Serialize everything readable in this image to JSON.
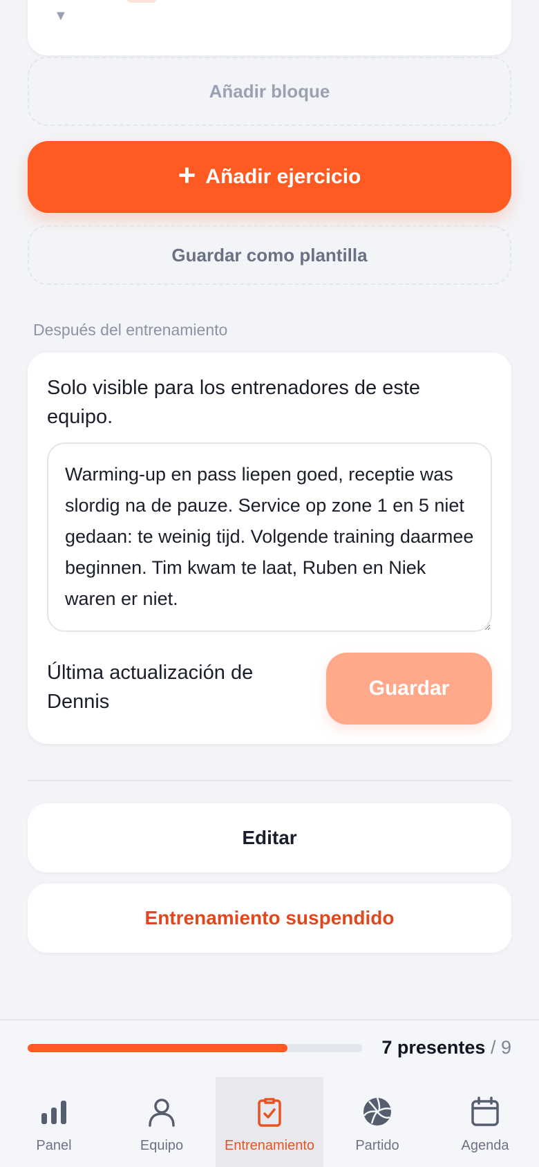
{
  "blocks": {
    "add_block_label": "Añadir bloque",
    "add_exercise_label": "Añadir ejercicio",
    "save_template_label": "Guardar como plantilla"
  },
  "after_training": {
    "section_title": "Después del entrenamiento",
    "visibility_hint": "Solo visible para los entrenadores de este equipo.",
    "notes_text": "Warming-up en pass liepen goed, receptie was slordig na de pauze. Service op zone 1 en 5 niet gedaan: te weinig tijd. Volgende training daarmee beginnen. Tim kwam te laat, Ruben en Niek waren er niet.",
    "last_updated": "Última actualización de Dennis",
    "save_label": "Guardar"
  },
  "actions": {
    "edit_label": "Editar",
    "suspend_label": "Entrenamiento suspendido"
  },
  "attendance": {
    "present_label": "7 presentes",
    "total_label": "/ 9",
    "present": 7,
    "total": 9
  },
  "tabs": [
    {
      "label": "Panel",
      "icon": "bar-chart-icon",
      "active": false
    },
    {
      "label": "Equipo",
      "icon": "user-icon",
      "active": false
    },
    {
      "label": "Entrenamiento",
      "icon": "clipboard-check-icon",
      "active": true
    },
    {
      "label": "Partido",
      "icon": "volleyball-icon",
      "active": false
    },
    {
      "label": "Agenda",
      "icon": "calendar-icon",
      "active": false
    }
  ],
  "colors": {
    "accent": "#ff5a22",
    "accent_light": "#ffa98a",
    "danger_text": "#e0471c",
    "background": "#f3f4f7"
  }
}
